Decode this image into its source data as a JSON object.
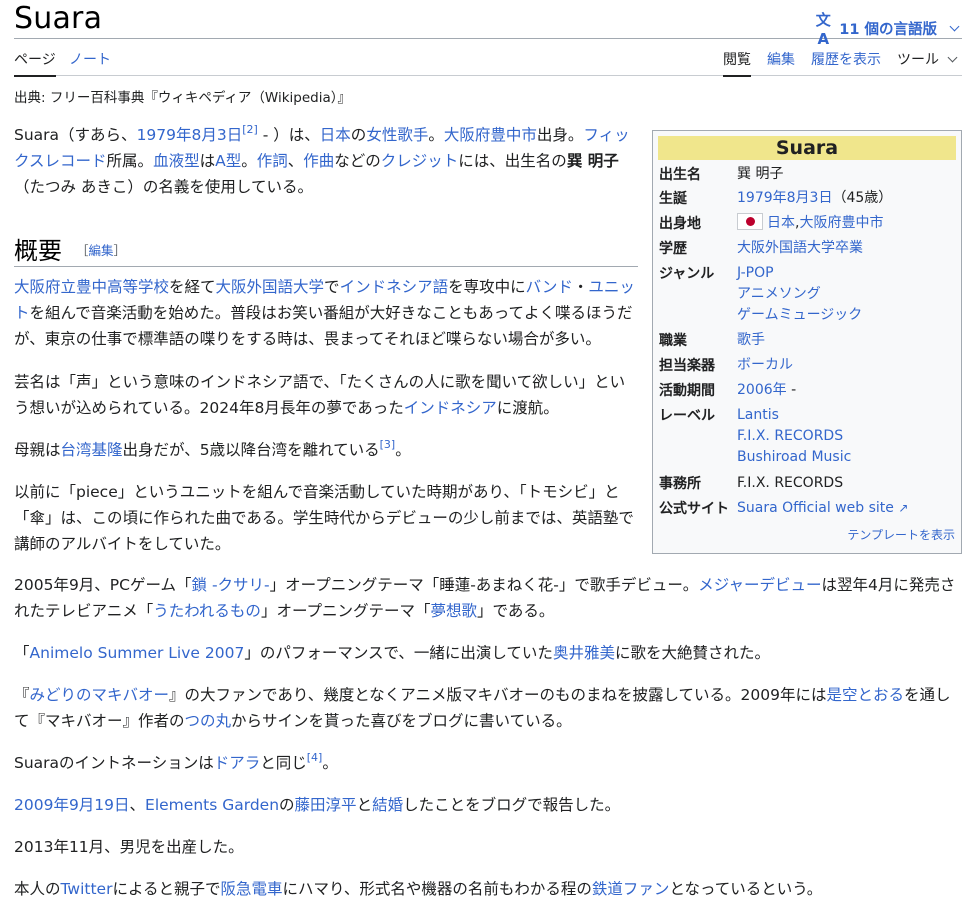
{
  "header": {
    "title": "Suara",
    "lang_icon": "文A",
    "lang_label": "11 個の言語版"
  },
  "tabs": {
    "page": "ページ",
    "talk": "ノート",
    "read": "閲覧",
    "edit": "編集",
    "history": "履歴を表示",
    "tools": "ツール"
  },
  "from_line": "出典: フリー百科事典『ウィキペディア（Wikipedia）』",
  "intro": {
    "t1": "Suara",
    "t2": "（すあら、",
    "l_birth": "1979年8月3日",
    "ref2": "[2]",
    "t3": " - ）は、",
    "l_japan": "日本",
    "t4": "の",
    "l_singer": "女性歌手",
    "t5": "。",
    "l_toyonaka": "大阪府豊中市",
    "t6": "出身。",
    "l_fix": "フィックスレコード",
    "t7": "所属。",
    "l_blood": "血液型",
    "t8": "は",
    "l_a": "A型",
    "t9": "。",
    "l_lyric": "作詞",
    "t10": "、",
    "l_comp": "作曲",
    "t11": "などの",
    "l_credit": "クレジット",
    "t12": "には、出生名の",
    "bold_name": "巽 明子",
    "t13": "（たつみ あきこ）の名義を使用している。"
  },
  "section": {
    "heading": "概要",
    "edit_open": "［",
    "edit_label": "編集",
    "edit_close": "］"
  },
  "p1": {
    "l_hs": "大阪府立豊中高等学校",
    "t1": "を経て",
    "l_univ": "大阪外国語大学",
    "t2": "で",
    "l_indo": "インドネシア語",
    "t3": "を専攻中に",
    "l_band": "バンド",
    "t4": "・",
    "l_unit": "ユニット",
    "t5": "を組んで音楽活動を始めた。普段はお笑い番組が大好きなこともあってよく喋るほうだが、東京の仕事で標準語の喋りをする時は、畏まってそれほど喋らない場合が多い。"
  },
  "p2": {
    "t1": "芸名は「声」という意味のインドネシア語で、「たくさんの人に歌を聞いて欲しい」という想いが込められている。2024年8月長年の夢であった",
    "l_indonesia": "インドネシア",
    "t2": "に渡航。"
  },
  "p3": {
    "t1": "母親は",
    "l_keelung": "台湾基隆",
    "t2": "出身だが、5歳以降台湾を離れている",
    "ref3": "[3]",
    "t3": "。"
  },
  "p4": {
    "t1": "以前に「piece」というユニットを組んで音楽活動していた時期があり、「トモシビ」と「傘」は、この頃に作られた曲である。学生時代からデビューの少し前までは、英語塾で講師のアルバイトをしていた。"
  },
  "p5": {
    "t1": "2005年9月、PCゲーム「",
    "l_kusari": "鎖 -クサリ-",
    "t2": "」オープニングテーマ「睡蓮-あまねく花-」で歌手デビュー。",
    "l_major": "メジャーデビュー",
    "t3": "は翌年4月に発売されたテレビアニメ「",
    "l_utaware": "うたわれるもの",
    "t4": "」オープニングテーマ「",
    "l_musouka": "夢想歌",
    "t5": "」である。"
  },
  "p6": {
    "t1": "「",
    "l_animelo": "Animelo Summer Live 2007",
    "t2": "」のパフォーマンスで、一緒に出演していた",
    "l_okui": "奥井雅美",
    "t3": "に歌を大絶賛された。"
  },
  "p7": {
    "t1": "『",
    "l_midori": "みどりのマキバオー",
    "t2": "』の大ファンであり、幾度となくアニメ版マキバオーのものまねを披露している。2009年には",
    "l_zekuu": "是空とおる",
    "t3": "を通して『マキバオー』作者の",
    "l_tsunomaru": "つの丸",
    "t4": "からサインを貰った喜びをブログに書いている。"
  },
  "p8": {
    "t1": "Suaraのイントネーションは",
    "l_doara": "ドアラ",
    "t2": "と同じ",
    "ref4": "[4]",
    "t3": "。"
  },
  "p9": {
    "l_date": "2009年9月19日",
    "t1": "、",
    "l_eg": "Elements Garden",
    "t2": "の",
    "l_fujita": "藤田淳平",
    "t3": "と",
    "l_marriage": "結婚",
    "t4": "したことをブログで報告した。"
  },
  "p10": {
    "t1": "2013年11月、男児を出産した。"
  },
  "p11": {
    "t1": "本人の",
    "l_twitter": "Twitter",
    "t2": "によると親子で",
    "l_hankyu": "阪急電車",
    "t3": "にハマり、形式名や機器の名前もわかる程の",
    "l_tetsudo": "鉄道ファン",
    "t4": "となっているという。"
  },
  "infobox": {
    "title": "Suara",
    "title_bg": "#f0e68c",
    "name_label": "出生名",
    "name_val": "巽 明子",
    "born_label": "生誕",
    "born_link": "1979年8月3日",
    "born_age": "（45歳）",
    "origin_label": "出身地",
    "flag_icon": "japan-flag-icon",
    "origin_japan": "日本",
    "origin_sep": ",",
    "origin_city": "大阪府豊中市",
    "edu_label": "学歴",
    "edu_val": "大阪外国語大学卒業",
    "genre_label": "ジャンル",
    "genres": [
      "J-POP",
      "アニメソング",
      "ゲームミュージック"
    ],
    "job_label": "職業",
    "job_val": "歌手",
    "inst_label": "担当楽器",
    "inst_val": "ボーカル",
    "active_label": "活動期間",
    "active_link": "2006年",
    "active_rest": " -",
    "label_label": "レーベル",
    "labels": [
      "Lantis",
      "F.I.X. RECORDS",
      "Bushiroad Music"
    ],
    "agency_label": "事務所",
    "agency_val": "F.I.X. RECORDS",
    "site_label": "公式サイト",
    "site_val": "Suara Official web site",
    "template_link": "テンプレートを表示"
  },
  "colors": {
    "link": "#3366cc",
    "text": "#202122",
    "border": "#a2a9b1"
  }
}
